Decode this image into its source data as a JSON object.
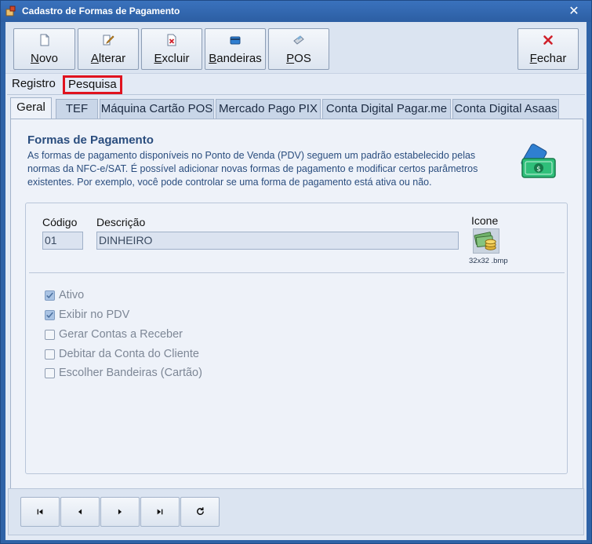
{
  "window": {
    "title": "Cadastro de Formas de Pagamento",
    "close_glyph": "✕"
  },
  "toolbar": {
    "buttons": [
      {
        "label": "Novo",
        "icon": "new-document-icon"
      },
      {
        "label": "Alterar",
        "icon": "edit-icon"
      },
      {
        "label": "Excluir",
        "icon": "delete-document-icon"
      },
      {
        "label": "Bandeiras",
        "icon": "card-icon"
      },
      {
        "label": "POS",
        "icon": "pos-terminal-icon"
      },
      {
        "label": "Fechar",
        "icon": "close-x-icon"
      }
    ]
  },
  "outer_tabs": [
    {
      "label": "Registro",
      "active": true
    },
    {
      "label": "Pesquisa",
      "active": false
    }
  ],
  "inner_tabs": [
    {
      "label": "Geral",
      "active": true
    },
    {
      "label": "TEF"
    },
    {
      "label": "Máquina Cartão POS"
    },
    {
      "label": "Mercado Pago PIX"
    },
    {
      "label": "Conta Digital Pagar.me"
    },
    {
      "label": "Conta Digital Asaas"
    }
  ],
  "info": {
    "title": "Formas de Pagamento",
    "description": "As formas de pagamento disponíveis no Ponto de Venda (PDV) seguem um padrão estabelecido pelas normas da NFC-e/SAT. É possível adicionar novas formas de pagamento e modificar certos parâmetros existentes. Por exemplo, você pode controlar se uma forma de pagamento está ativa ou não."
  },
  "form": {
    "codigo_label": "Código",
    "codigo_value": "01",
    "descricao_label": "Descrição",
    "descricao_value": "DINHEIRO",
    "icone_label": "Icone",
    "icone_caption": "32x32 .bmp"
  },
  "checkboxes": [
    {
      "label": "Ativo",
      "checked": true
    },
    {
      "label": "Exibir no PDV",
      "checked": true
    },
    {
      "label": "Gerar Contas a Receber",
      "checked": false
    },
    {
      "label": "Debitar da Conta do Cliente",
      "checked": false
    },
    {
      "label": "Escolher Bandeiras (Cartão)",
      "checked": false
    }
  ],
  "navigator": {
    "buttons": [
      {
        "name": "first-record-icon"
      },
      {
        "name": "prior-record-icon"
      },
      {
        "name": "next-record-icon"
      },
      {
        "name": "last-record-icon"
      },
      {
        "name": "refresh-icon"
      }
    ]
  },
  "colors": {
    "window_frame": "#2f63a7",
    "highlight_border": "#e0131f",
    "section_text": "#2a4d7e"
  }
}
